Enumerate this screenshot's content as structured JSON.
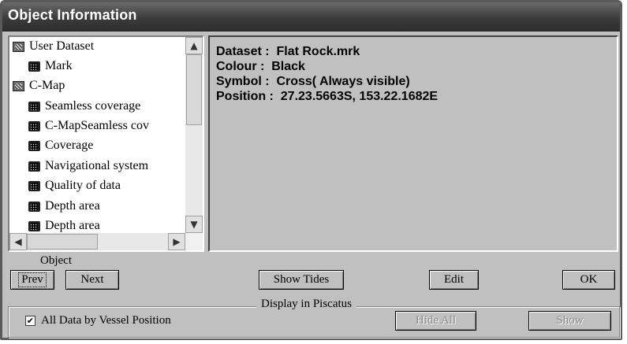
{
  "window": {
    "title": "Object Information"
  },
  "tree": {
    "items": [
      {
        "label": "User Dataset",
        "icon": "folder-icon",
        "level": 0
      },
      {
        "label": "Mark",
        "icon": "layer-icon",
        "level": 1
      },
      {
        "label": "C-Map",
        "icon": "folder-icon",
        "level": 0
      },
      {
        "label": "Seamless coverage",
        "icon": "layer-icon",
        "level": 1
      },
      {
        "label": "C-MapSeamless cov",
        "icon": "layer-icon",
        "level": 1
      },
      {
        "label": "Coverage",
        "icon": "layer-icon",
        "level": 1
      },
      {
        "label": "Navigational system",
        "icon": "layer-icon",
        "level": 1
      },
      {
        "label": "Quality of data",
        "icon": "layer-icon",
        "level": 1
      },
      {
        "label": "Depth area",
        "icon": "layer-icon",
        "level": 1
      },
      {
        "label": "Depth area",
        "icon": "layer-icon",
        "level": 1
      }
    ],
    "scroll_up": "▲",
    "scroll_down": "▼",
    "scroll_left": "◀",
    "scroll_right": "▶"
  },
  "info": {
    "lines": [
      "Dataset :  Flat Rock.mrk",
      "Colour :  Black",
      "Symbol :  Cross( Always visible)",
      "Position :  27.23.5663S, 153.22.1682E"
    ]
  },
  "object_group": {
    "label": "Object"
  },
  "buttons": {
    "prev": "Prev",
    "next": "Next",
    "show_tides": "Show Tides",
    "edit": "Edit",
    "ok": "OK",
    "hide_all": "Hide All",
    "show": "Show"
  },
  "display_group": {
    "title": "Display in Piscatus",
    "checkbox_label": "All Data by Vessel Position",
    "checkbox_checked": true,
    "check_mark": "✔"
  }
}
